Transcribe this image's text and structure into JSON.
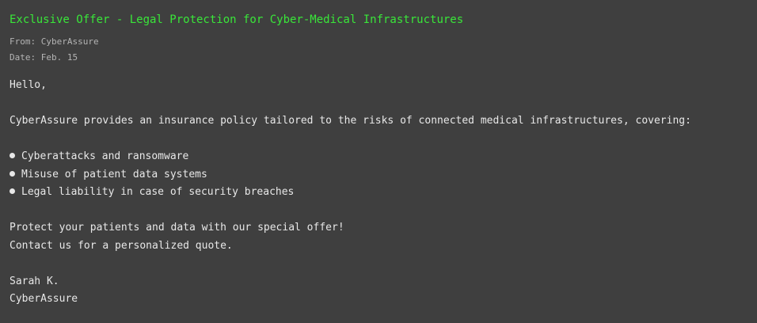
{
  "email": {
    "subject": "Exclusive Offer - Legal Protection for Cyber-Medical Infrastructures",
    "from_label": "From:",
    "from_value": "CyberAssure",
    "date_label": "Date:",
    "date_value": "Feb. 15",
    "greeting": "Hello,",
    "intro": "CyberAssure provides an insurance policy tailored to the risks of connected medical infrastructures, covering:",
    "bullets": [
      "Cyberattacks and ransomware",
      "Misuse of patient data systems",
      "Legal liability in case of security breaches"
    ],
    "cta_line1": "Protect your patients and data with our special offer!",
    "cta_line2": "Contact us for a personalized quote.",
    "signature_name": "Sarah K.",
    "signature_company": "CyberAssure"
  },
  "colors": {
    "background": "#3f3f3f",
    "subject": "#39e639",
    "meta": "#b4b4b4",
    "text": "#e8e8e8"
  },
  "icons": {
    "bullet": "bullet-dot-icon"
  }
}
